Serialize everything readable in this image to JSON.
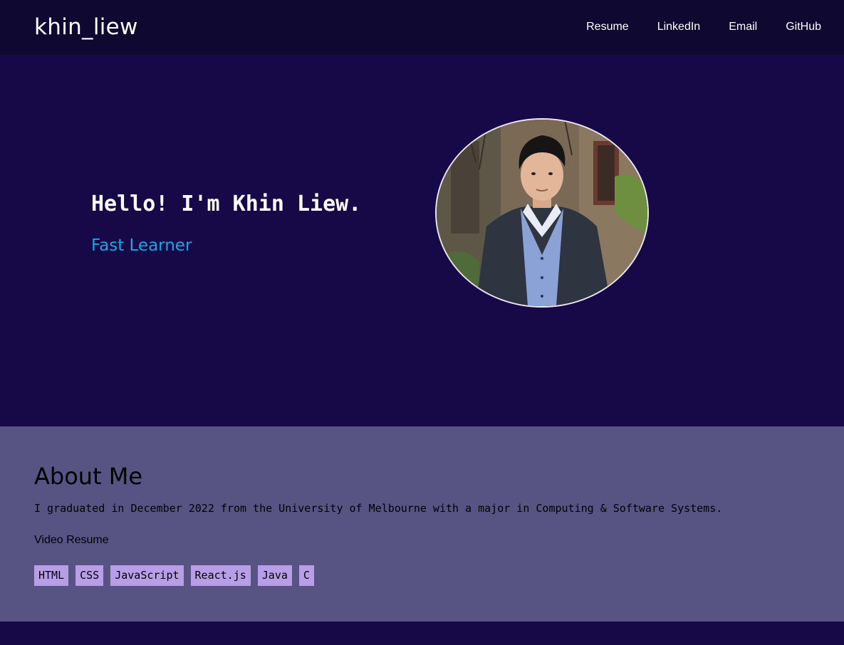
{
  "navbar": {
    "brand": "khin_liew",
    "links": [
      {
        "label": "Resume"
      },
      {
        "label": "LinkedIn"
      },
      {
        "label": "Email"
      },
      {
        "label": "GitHub"
      }
    ]
  },
  "hero": {
    "title": "Hello! I'm Khin Liew.",
    "subtitle": "Fast Learner"
  },
  "about": {
    "heading": "About Me",
    "text": "I graduated in December 2022 from the University of Melbourne with a major in Computing & Software Systems.",
    "video_link": "Video Resume",
    "skills": [
      "HTML",
      "CSS",
      "JavaScript",
      "React.js",
      "Java",
      "C"
    ]
  },
  "colors": {
    "navbar_bg": "#0f0830",
    "page_bg": "#170948",
    "about_bg": "#575383",
    "accent": "#17a8e8",
    "tag_bg": "#b89ee6"
  }
}
